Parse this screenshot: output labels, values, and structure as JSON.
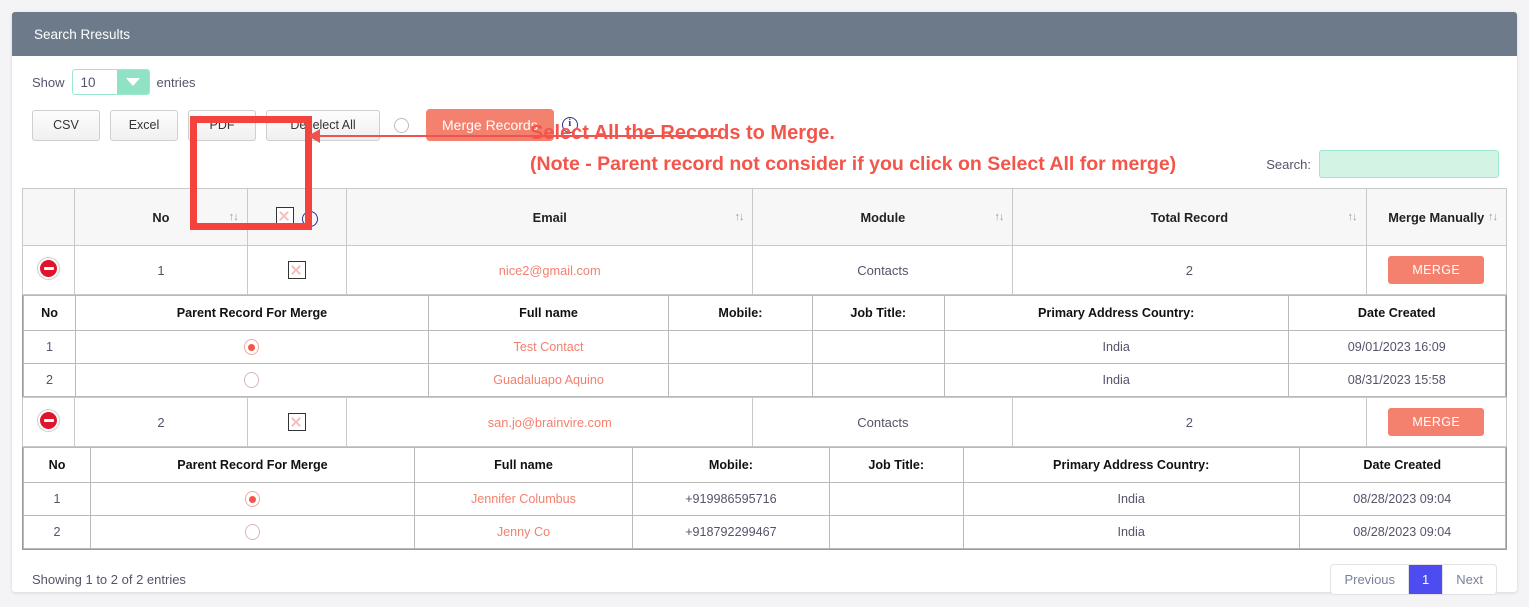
{
  "panel": {
    "title": "Search Rresults"
  },
  "toolbar": {
    "show_label": "Show",
    "entries_label": "entries",
    "page_length": "10",
    "dropdown_icon": "chevron-down-icon",
    "buttons": [
      {
        "label": "CSV",
        "name": "export-csv-button"
      },
      {
        "label": "Excel",
        "name": "export-excel-button"
      },
      {
        "label": "PDF",
        "name": "export-pdf-button"
      },
      {
        "label": "Deselect All",
        "name": "deselect-all-button"
      }
    ],
    "merge_records_label": "Merge Records",
    "info_icon": "info-icon"
  },
  "search": {
    "label": "Search:",
    "value": "",
    "placeholder": ""
  },
  "annotation": {
    "line1": "Select All the Records to Merge.",
    "line2": "(Note - Parent record not consider if you click on Select All for merge)",
    "color": "#f4554a"
  },
  "main_table": {
    "columns": [
      "",
      "No",
      "",
      "Email",
      "Module",
      "Total Record",
      "Merge Manually"
    ],
    "header_checkbox_icon": "checkbox-icon",
    "header_info_icon": "info-icon",
    "sort_icon": "sort-updown-icon",
    "rows": [
      {
        "collapse_icon": "collapse-minus-icon",
        "no": "1",
        "checkbox_icon": "checkbox-icon",
        "email": "nice2@gmail.com",
        "module": "Contacts",
        "total_record": "2",
        "merge_label": "MERGE"
      },
      {
        "collapse_icon": "collapse-minus-icon",
        "no": "2",
        "checkbox_icon": "checkbox-icon",
        "email": "san.jo@brainvire.com",
        "module": "Contacts",
        "total_record": "2",
        "merge_label": "MERGE"
      }
    ]
  },
  "sub_tables": [
    {
      "columns": [
        "No",
        "Parent Record For Merge",
        "Full name",
        "Mobile:",
        "Job Title:",
        "Primary Address Country:",
        "Date Created"
      ],
      "rows": [
        {
          "no": "1",
          "parent_selected": true,
          "full_name": "Test Contact",
          "mobile": "",
          "job_title": "",
          "country": "India",
          "date_created": "09/01/2023 16:09"
        },
        {
          "no": "2",
          "parent_selected": false,
          "full_name": "Guadaluapo Aquino",
          "mobile": "",
          "job_title": "",
          "country": "India",
          "date_created": "08/31/2023 15:58"
        }
      ]
    },
    {
      "columns": [
        "No",
        "Parent Record For Merge",
        "Full name",
        "Mobile:",
        "Job Title:",
        "Primary Address Country:",
        "Date Created"
      ],
      "rows": [
        {
          "no": "1",
          "parent_selected": true,
          "full_name": "Jennifer Columbus",
          "mobile": "+919986595716",
          "job_title": "",
          "country": "India",
          "date_created": "08/28/2023 09:04"
        },
        {
          "no": "2",
          "parent_selected": false,
          "full_name": "Jenny Co",
          "mobile": "+918792299467",
          "job_title": "",
          "country": "India",
          "date_created": "08/28/2023 09:04"
        }
      ]
    }
  ],
  "footer": {
    "showing": "Showing 1 to 2 of 2 entries",
    "pagination": {
      "previous": "Previous",
      "pages": [
        "1"
      ],
      "next": "Next",
      "active": "1",
      "active_color": "#4c4cf0"
    }
  }
}
